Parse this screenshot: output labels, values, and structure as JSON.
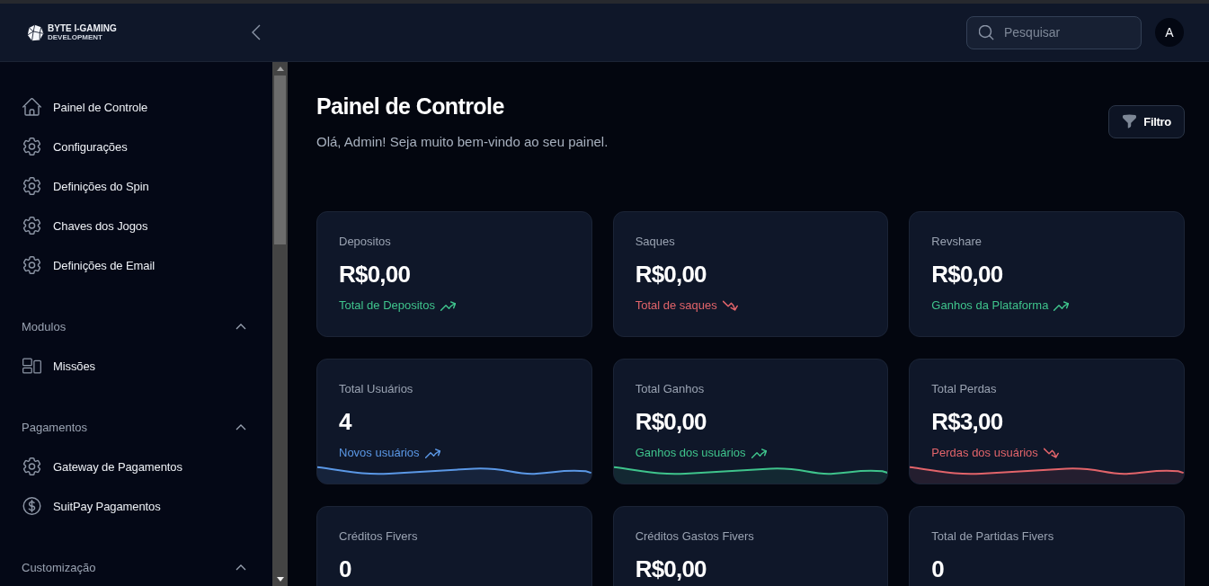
{
  "header": {
    "logo": {
      "name": "BYTE I-GAMING",
      "tagline": "DEVELOPMENT"
    },
    "search": {
      "placeholder": "Pesquisar"
    },
    "avatar": {
      "initial": "A"
    }
  },
  "sidebar": {
    "groups": [
      {
        "items": [
          {
            "label": "Painel de Controle",
            "kind": "home"
          },
          {
            "label": "Configurações",
            "kind": "settings"
          },
          {
            "label": "Definições do Spin",
            "kind": "settings"
          },
          {
            "label": "Chaves dos Jogos",
            "kind": "settings"
          },
          {
            "label": "Definições de Email",
            "kind": "settings"
          }
        ]
      },
      {
        "title": "Modulos",
        "expanded": true,
        "items": [
          {
            "label": "Missões",
            "kind": "layout"
          }
        ]
      },
      {
        "title": "Pagamentos",
        "expanded": true,
        "items": [
          {
            "label": "Gateway de Pagamentos",
            "kind": "settings"
          },
          {
            "label": "SuitPay Pagamentos",
            "kind": "money"
          }
        ]
      },
      {
        "title": "Customização",
        "expanded": true
      }
    ]
  },
  "main": {
    "title": "Painel de Controle",
    "subtitle": "Olá, Admin! Seja muito bem-vindo ao seu painel.",
    "filter_button": "Filtro",
    "cards": [
      {
        "kind": "plain",
        "label": "Depositos",
        "value": "R$0,00",
        "trend": {
          "text": "Total de Depositos",
          "kind": "up",
          "color": "#3fc48c"
        }
      },
      {
        "kind": "plain",
        "label": "Saques",
        "value": "R$0,00",
        "trend": {
          "text": "Total de saques",
          "kind": "down",
          "color": "#e2646a"
        }
      },
      {
        "kind": "plain",
        "label": "Revshare",
        "value": "R$0,00",
        "trend": {
          "text": "Ganhos da Plataforma",
          "kind": "up",
          "color": "#3fc48c"
        }
      },
      {
        "kind": "sparkline",
        "label": "Total Usuários",
        "value": "4",
        "trend": {
          "text": "Novos usuários",
          "kind": "up",
          "color": "#5b98e6"
        }
      },
      {
        "kind": "sparkline",
        "label": "Total Ganhos",
        "value": "R$0,00",
        "trend": {
          "text": "Ganhos dos usuários",
          "kind": "up",
          "color": "#3fc48c"
        }
      },
      {
        "kind": "sparkline",
        "label": "Total Perdas",
        "value": "R$3,00",
        "trend": {
          "text": "Perdas dos usuários",
          "kind": "down",
          "color": "#e2646a"
        }
      },
      {
        "kind": "plain",
        "label": "Créditos Fivers",
        "value": "0"
      },
      {
        "kind": "plain",
        "label": "Créditos Gastos Fivers",
        "value": "R$0,00"
      },
      {
        "kind": "plain",
        "label": "Total de Partidas Fivers",
        "value": "0"
      }
    ]
  }
}
